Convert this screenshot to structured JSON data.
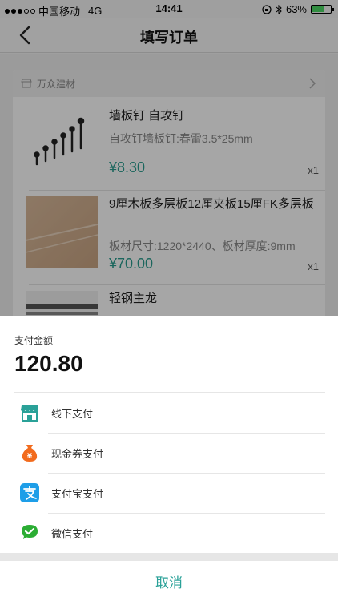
{
  "status_bar": {
    "carrier": "中国移动",
    "network": "4G",
    "time": "14:41",
    "battery_percent": "63%",
    "battery_level": 0.63
  },
  "nav": {
    "title": "填写订单"
  },
  "store": {
    "name": "万众建材"
  },
  "products": [
    {
      "name": "墙板钉 自攻钉",
      "spec": "自攻钉墙板钉:春雷3.5*25mm",
      "price": "¥8.30",
      "qty": "x1"
    },
    {
      "name": "9厘木板多层板12厘夹板15厘FK多层板",
      "spec": "板材尺寸:1220*2440、板材厚度:9mm",
      "price": "¥70.00",
      "qty": "x1"
    },
    {
      "name": "轻钢主龙",
      "spec": "",
      "price": "",
      "qty": ""
    }
  ],
  "payment": {
    "amount_label": "支付金额",
    "amount": "120.80",
    "methods": [
      {
        "label": "线下支付",
        "icon": "store-icon",
        "color": "#2aa198"
      },
      {
        "label": "现金券支付",
        "icon": "money-bag-icon",
        "color": "#f26b1d"
      },
      {
        "label": "支付宝支付",
        "icon": "alipay-icon",
        "color": "#1e9ee8"
      },
      {
        "label": "微信支付",
        "icon": "wechat-pay-icon",
        "color": "#2bad33"
      }
    ],
    "cancel_label": "取消"
  },
  "colors": {
    "accent": "#2aa198",
    "price": "#2a9d8f"
  }
}
